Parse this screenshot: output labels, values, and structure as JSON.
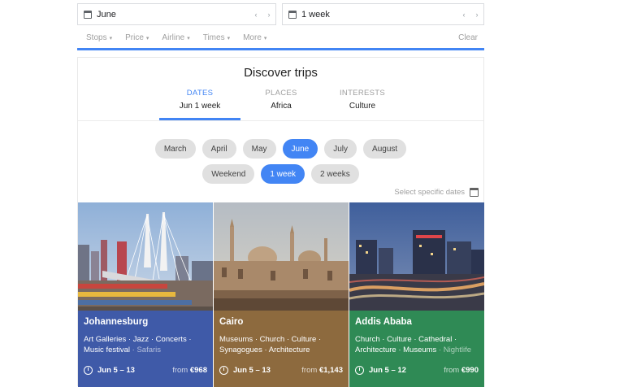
{
  "search": {
    "month": {
      "value": "June",
      "prev": "‹",
      "next": "›"
    },
    "duration": {
      "value": "1 week",
      "prev": "‹",
      "next": "›"
    }
  },
  "filters": [
    "Stops",
    "Price",
    "Airline",
    "Times",
    "More"
  ],
  "clear_label": "Clear",
  "discover": {
    "title": "Discover trips",
    "tabs": [
      {
        "header": "DATES",
        "value": "Jun 1 week"
      },
      {
        "header": "PLACES",
        "value": "Africa"
      },
      {
        "header": "INTERESTS",
        "value": "Culture"
      }
    ],
    "months": [
      "March",
      "April",
      "May",
      "June",
      "July",
      "August"
    ],
    "selected_month": "June",
    "durations": [
      "Weekend",
      "1 week",
      "2 weeks"
    ],
    "selected_duration": "1 week",
    "specific_dates_label": "Select specific dates"
  },
  "destinations": [
    {
      "name": "Johannesburg",
      "tags": "Art Galleries · Jazz · Concerts · Music festival",
      "tags_dim": "· Safaris",
      "dates": "Jun 5 – 13",
      "price_prefix": "from",
      "price": "€968",
      "color": "#3f5aa8"
    },
    {
      "name": "Cairo",
      "tags": "Museums · Church · Culture · Synagogues · Architecture",
      "tags_dim": "",
      "dates": "Jun 5 – 13",
      "price_prefix": "from",
      "price": "€1,143",
      "color": "#8d6a3e"
    },
    {
      "name": "Addis Ababa",
      "tags": "Church · Culture · Cathedral · Architecture · Museums",
      "tags_dim": "· Nightlife",
      "dates": "Jun 5 – 12",
      "price_prefix": "from",
      "price": "€990",
      "color": "#2f8a55"
    }
  ],
  "colors": {
    "accent": "#4285f4",
    "chip": "#e0e0e0"
  }
}
